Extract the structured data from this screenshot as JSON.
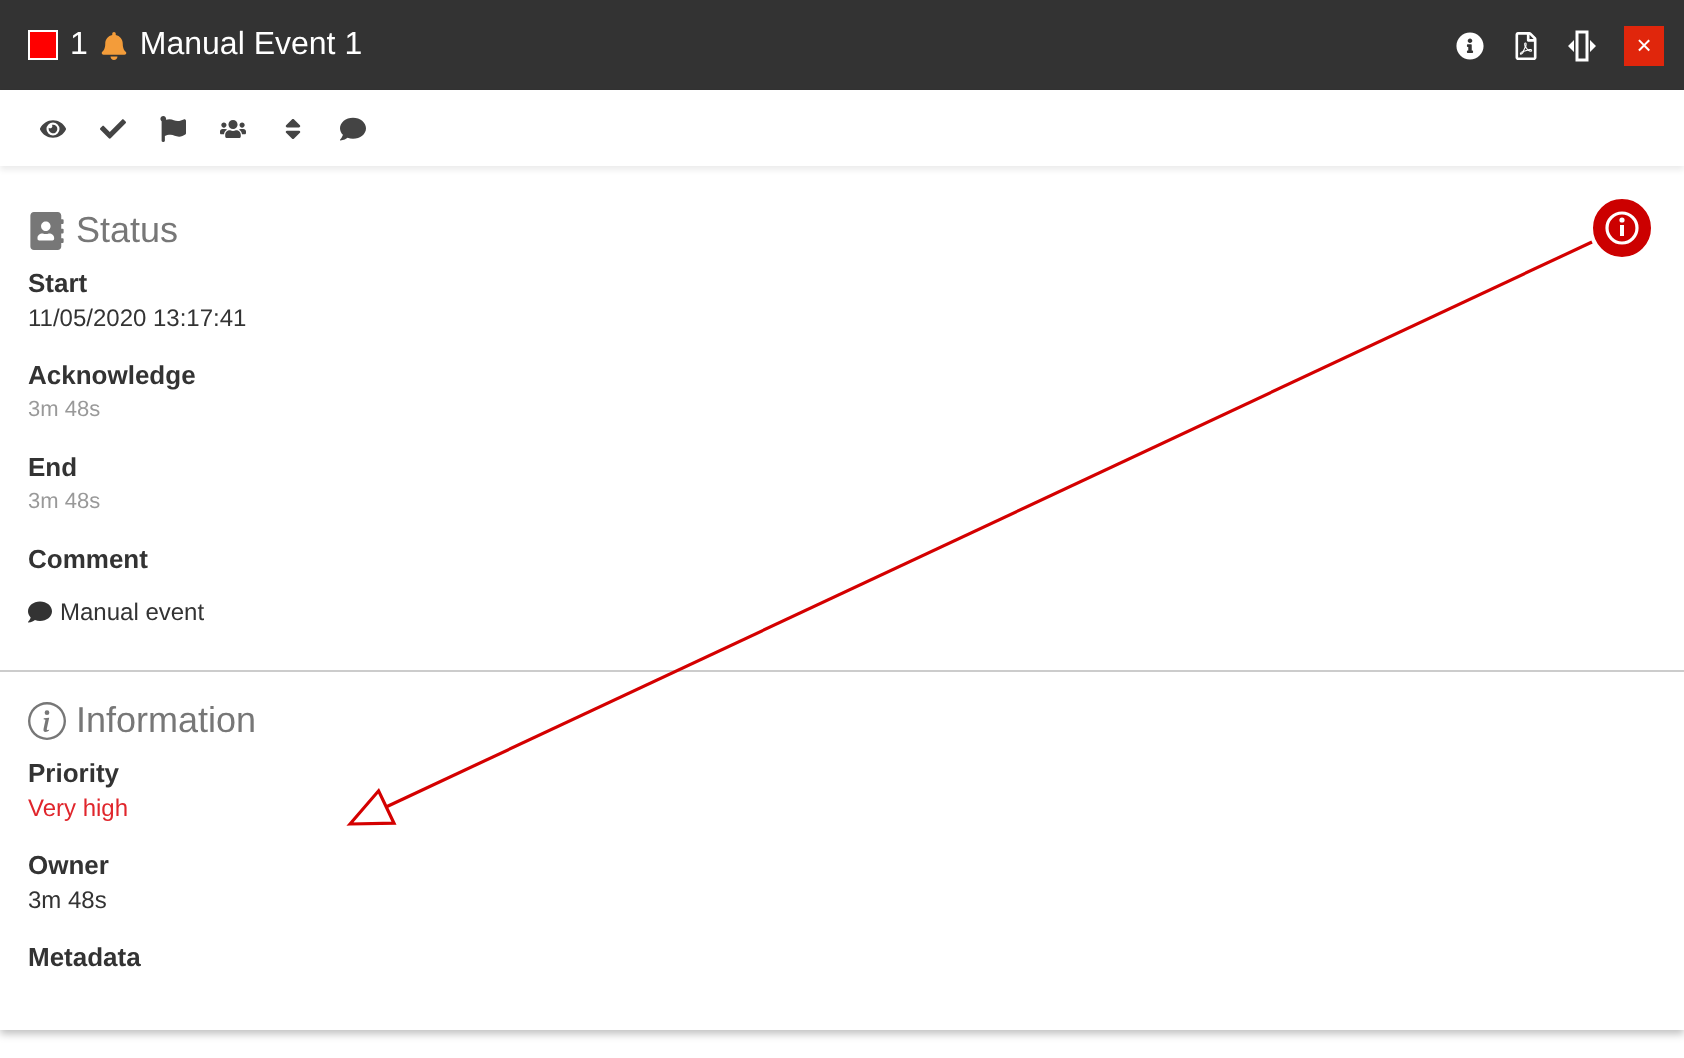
{
  "header": {
    "color": "#ff0000",
    "number": "1",
    "title": "Manual Event 1",
    "close": "×"
  },
  "sections": [
    {
      "kind": "status",
      "title": "Status",
      "fields": [
        {
          "label": "Start",
          "value": "11/05/2020 13:17:41",
          "kind": "plain"
        },
        {
          "label": "Acknowledge",
          "value": "3m 48s",
          "kind": "muted"
        },
        {
          "label": "End",
          "value": "3m 48s",
          "kind": "muted"
        },
        {
          "label": "Comment",
          "value": "Manual event",
          "kind": "comment"
        }
      ]
    },
    {
      "kind": "information",
      "title": "Information",
      "fields": [
        {
          "label": "Priority",
          "value": "Very high",
          "kind": "alert"
        },
        {
          "label": "Owner",
          "value": "3m 48s",
          "kind": "plain"
        },
        {
          "label": "Metadata"
        }
      ]
    }
  ]
}
